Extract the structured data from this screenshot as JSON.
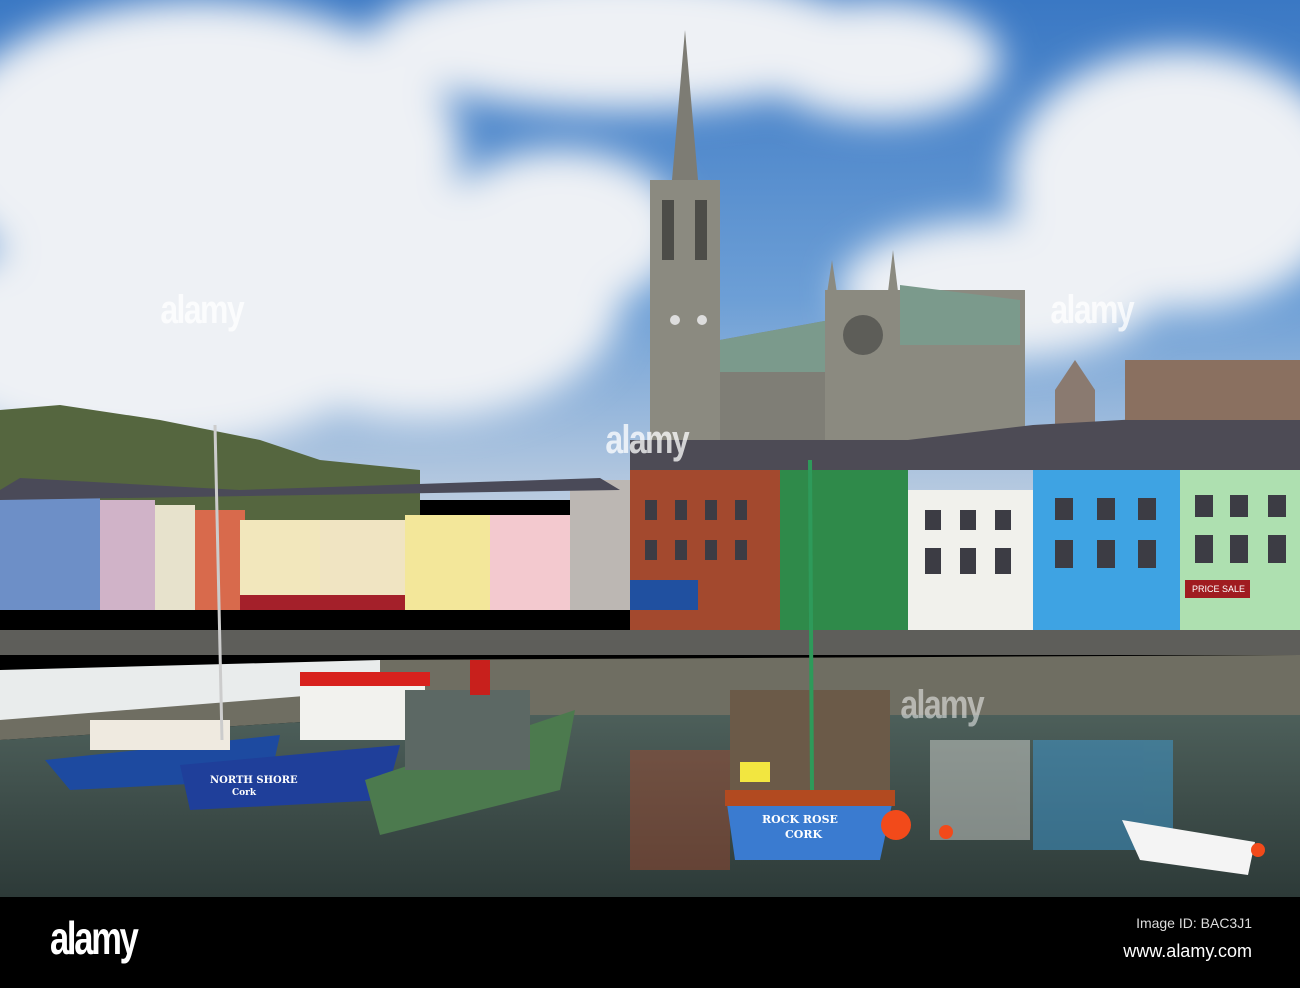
{
  "photo": {
    "subject": "Cobh harbour with St Colman's Cathedral",
    "boats": [
      {
        "name": "NORTH SHORE",
        "port": "Cork"
      },
      {
        "name": "ROCK ROSE",
        "port": "CORK"
      }
    ],
    "signs": [
      "PRICE SALE"
    ],
    "watermark": "alamy"
  },
  "footer": {
    "logo": "alamy",
    "image_id": "Image ID: BAC3J1",
    "url": "www.alamy.com"
  }
}
